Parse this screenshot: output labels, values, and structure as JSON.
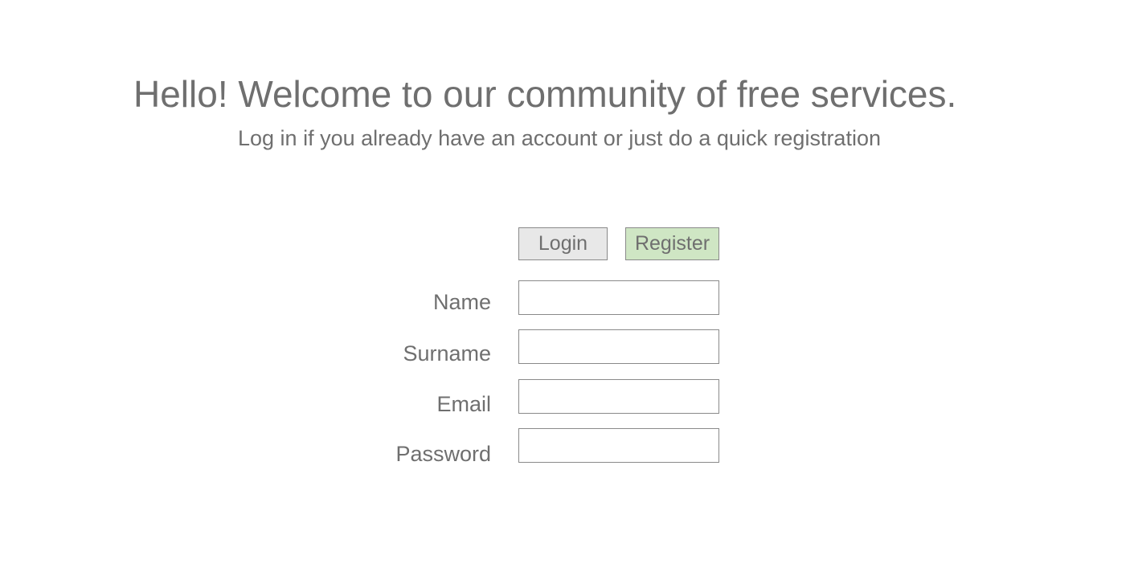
{
  "header": {
    "title": "Hello! Welcome to our community of free services.",
    "subtitle": "Log in if you already have an account or just do a quick registration"
  },
  "tabs": {
    "login_label": "Login",
    "register_label": "Register",
    "active": "Register"
  },
  "form": {
    "fields": [
      {
        "label": "Name",
        "value": "",
        "placeholder": ""
      },
      {
        "label": "Surname",
        "value": "",
        "placeholder": ""
      },
      {
        "label": "Email",
        "value": "",
        "placeholder": ""
      },
      {
        "label": "Password",
        "value": "",
        "placeholder": ""
      }
    ]
  },
  "colors": {
    "text": "#6f6f6f",
    "login_tab_bg": "#e8e8e8",
    "register_tab_bg": "#cfe6c4",
    "border": "#8a8a8a"
  }
}
